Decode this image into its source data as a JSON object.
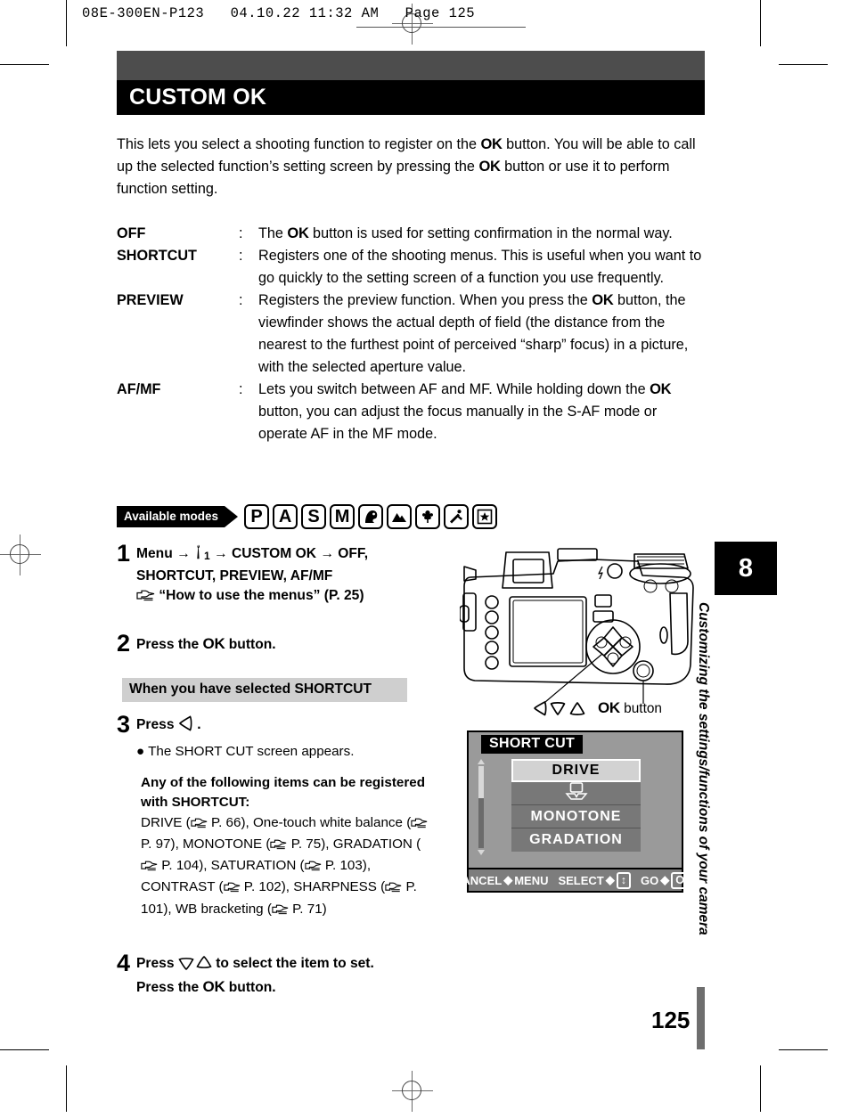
{
  "print_header": {
    "text": "08E-300EN-P123   04.10.22 11:32 AM   Page 125"
  },
  "banner": {
    "title": "CUSTOM OK"
  },
  "intro": {
    "part1": "This lets you select a shooting function to register on the ",
    "ok1": "OK",
    "part2": " button. You will be able to call up the selected function’s setting screen by pressing the ",
    "ok2": "OK",
    "part3": " button or use it to perform function setting."
  },
  "definitions": [
    {
      "term": "OFF",
      "colon": ":",
      "desc_pre": "The ",
      "ok": "OK",
      "desc_post": " button is used for setting confirmation in the normal way."
    },
    {
      "term": "SHORTCUT",
      "colon": ":",
      "desc_pre": "Registers one of the shooting menus. This is useful when you want to go quickly to the setting screen of a function you use frequently.",
      "ok": "",
      "desc_post": ""
    },
    {
      "term": "PREVIEW",
      "colon": ":",
      "desc_pre": "Registers the preview function. When you press the ",
      "ok": "OK",
      "desc_post": " button, the viewfinder shows the actual depth of field (the distance from the nearest to the furthest point of perceived “sharp” focus) in a picture, with the selected aperture value."
    },
    {
      "term": "AF/MF",
      "colon": ":",
      "desc_pre": "Lets you switch between AF and MF. While holding down the ",
      "ok": "OK",
      "desc_post": " button, you can adjust the focus manually in the S-AF mode or operate AF in the MF mode."
    }
  ],
  "available_modes": {
    "label": "Available modes",
    "icons": [
      {
        "name": "mode-program-icon",
        "glyph": "P"
      },
      {
        "name": "mode-aperture-icon",
        "glyph": "A"
      },
      {
        "name": "mode-shutter-icon",
        "glyph": "S"
      },
      {
        "name": "mode-manual-icon",
        "glyph": "M"
      },
      {
        "name": "mode-portrait-icon",
        "glyph": ""
      },
      {
        "name": "mode-landscape-icon",
        "glyph": ""
      },
      {
        "name": "mode-macro-icon",
        "glyph": ""
      },
      {
        "name": "mode-sports-icon",
        "glyph": ""
      },
      {
        "name": "mode-night-scene-icon",
        "glyph": ""
      }
    ]
  },
  "steps": {
    "step1": {
      "num": "1",
      "line1_a": "Menu",
      "arrow": "→",
      "wrench_sub": "1",
      "line1_b": "CUSTOM OK",
      "line1_c": "OFF,",
      "line2": "SHORTCUT, PREVIEW, AF/MF",
      "line3": "“How to use the menus” (P. 25)"
    },
    "step2": {
      "num": "2",
      "pre": "Press the ",
      "ok": "OK",
      "post": " button."
    },
    "shortcut_head": "When you have selected SHORTCUT",
    "step3": {
      "num": "3",
      "pre": "Press",
      "post": ".",
      "bullet": "The SHORT CUT screen appears."
    },
    "note": {
      "heading": "Any of the following items can be registered with SHORTCUT:",
      "body_parts": [
        {
          "text": "DRIVE (",
          "ref": "P. 66",
          "tail": "), One-touch white balance"
        },
        {
          "text": "(",
          "ref": "P. 97",
          "tail": "), MONOTONE ("
        },
        {
          "text": "",
          "ref": "P. 75",
          "tail": "),"
        },
        {
          "text": "GRADATION (",
          "ref": "P. 104",
          "tail": "), SATURATION"
        },
        {
          "text": "(",
          "ref": "P. 103",
          "tail": "), CONTRAST ("
        },
        {
          "text": "",
          "ref": "P. 102",
          "tail": "),"
        },
        {
          "text": "SHARPNESS (",
          "ref": "P. 101",
          "tail": "), WB bracketing"
        },
        {
          "text": "(",
          "ref": "P. 71",
          "tail": ")"
        }
      ]
    },
    "step4": {
      "num": "4",
      "pre": "Press",
      "mid": "to select the item to set.",
      "line2_pre": "Press the ",
      "ok": "OK",
      "line2_post": " button."
    }
  },
  "camera_figure": {
    "arrowpad_caption": "",
    "ok_button_label_pre": "OK",
    "ok_button_label_post": " button"
  },
  "lcd_screen": {
    "title": "SHORT CUT",
    "rows": [
      {
        "label": "DRIVE",
        "selected": true,
        "icon": false
      },
      {
        "label": "",
        "selected": false,
        "icon": true
      },
      {
        "label": "MONOTONE",
        "selected": false,
        "icon": false
      },
      {
        "label": "GRADATION",
        "selected": false,
        "icon": false
      }
    ],
    "bottom_bar": {
      "cancel_label": "CANCEL",
      "cancel_target": "MENU",
      "select_label": "SELECT",
      "select_key": "↕",
      "go_label": "GO",
      "go_key": "OK",
      "diamond": "◆"
    }
  },
  "chapter": {
    "number": "8",
    "text": "Customizing the settings/functions of your camera"
  },
  "page_number": "125",
  "colors": {
    "banner_top": "#4d4d4d",
    "banner_bottom": "#000000",
    "shortcut_head_bg": "#cfcfcf",
    "lcd_bg": "#9a9a9a",
    "lcd_row": "#787878",
    "lcd_selected": "#d2d2d2",
    "page_bar": "#6e6e6e"
  }
}
